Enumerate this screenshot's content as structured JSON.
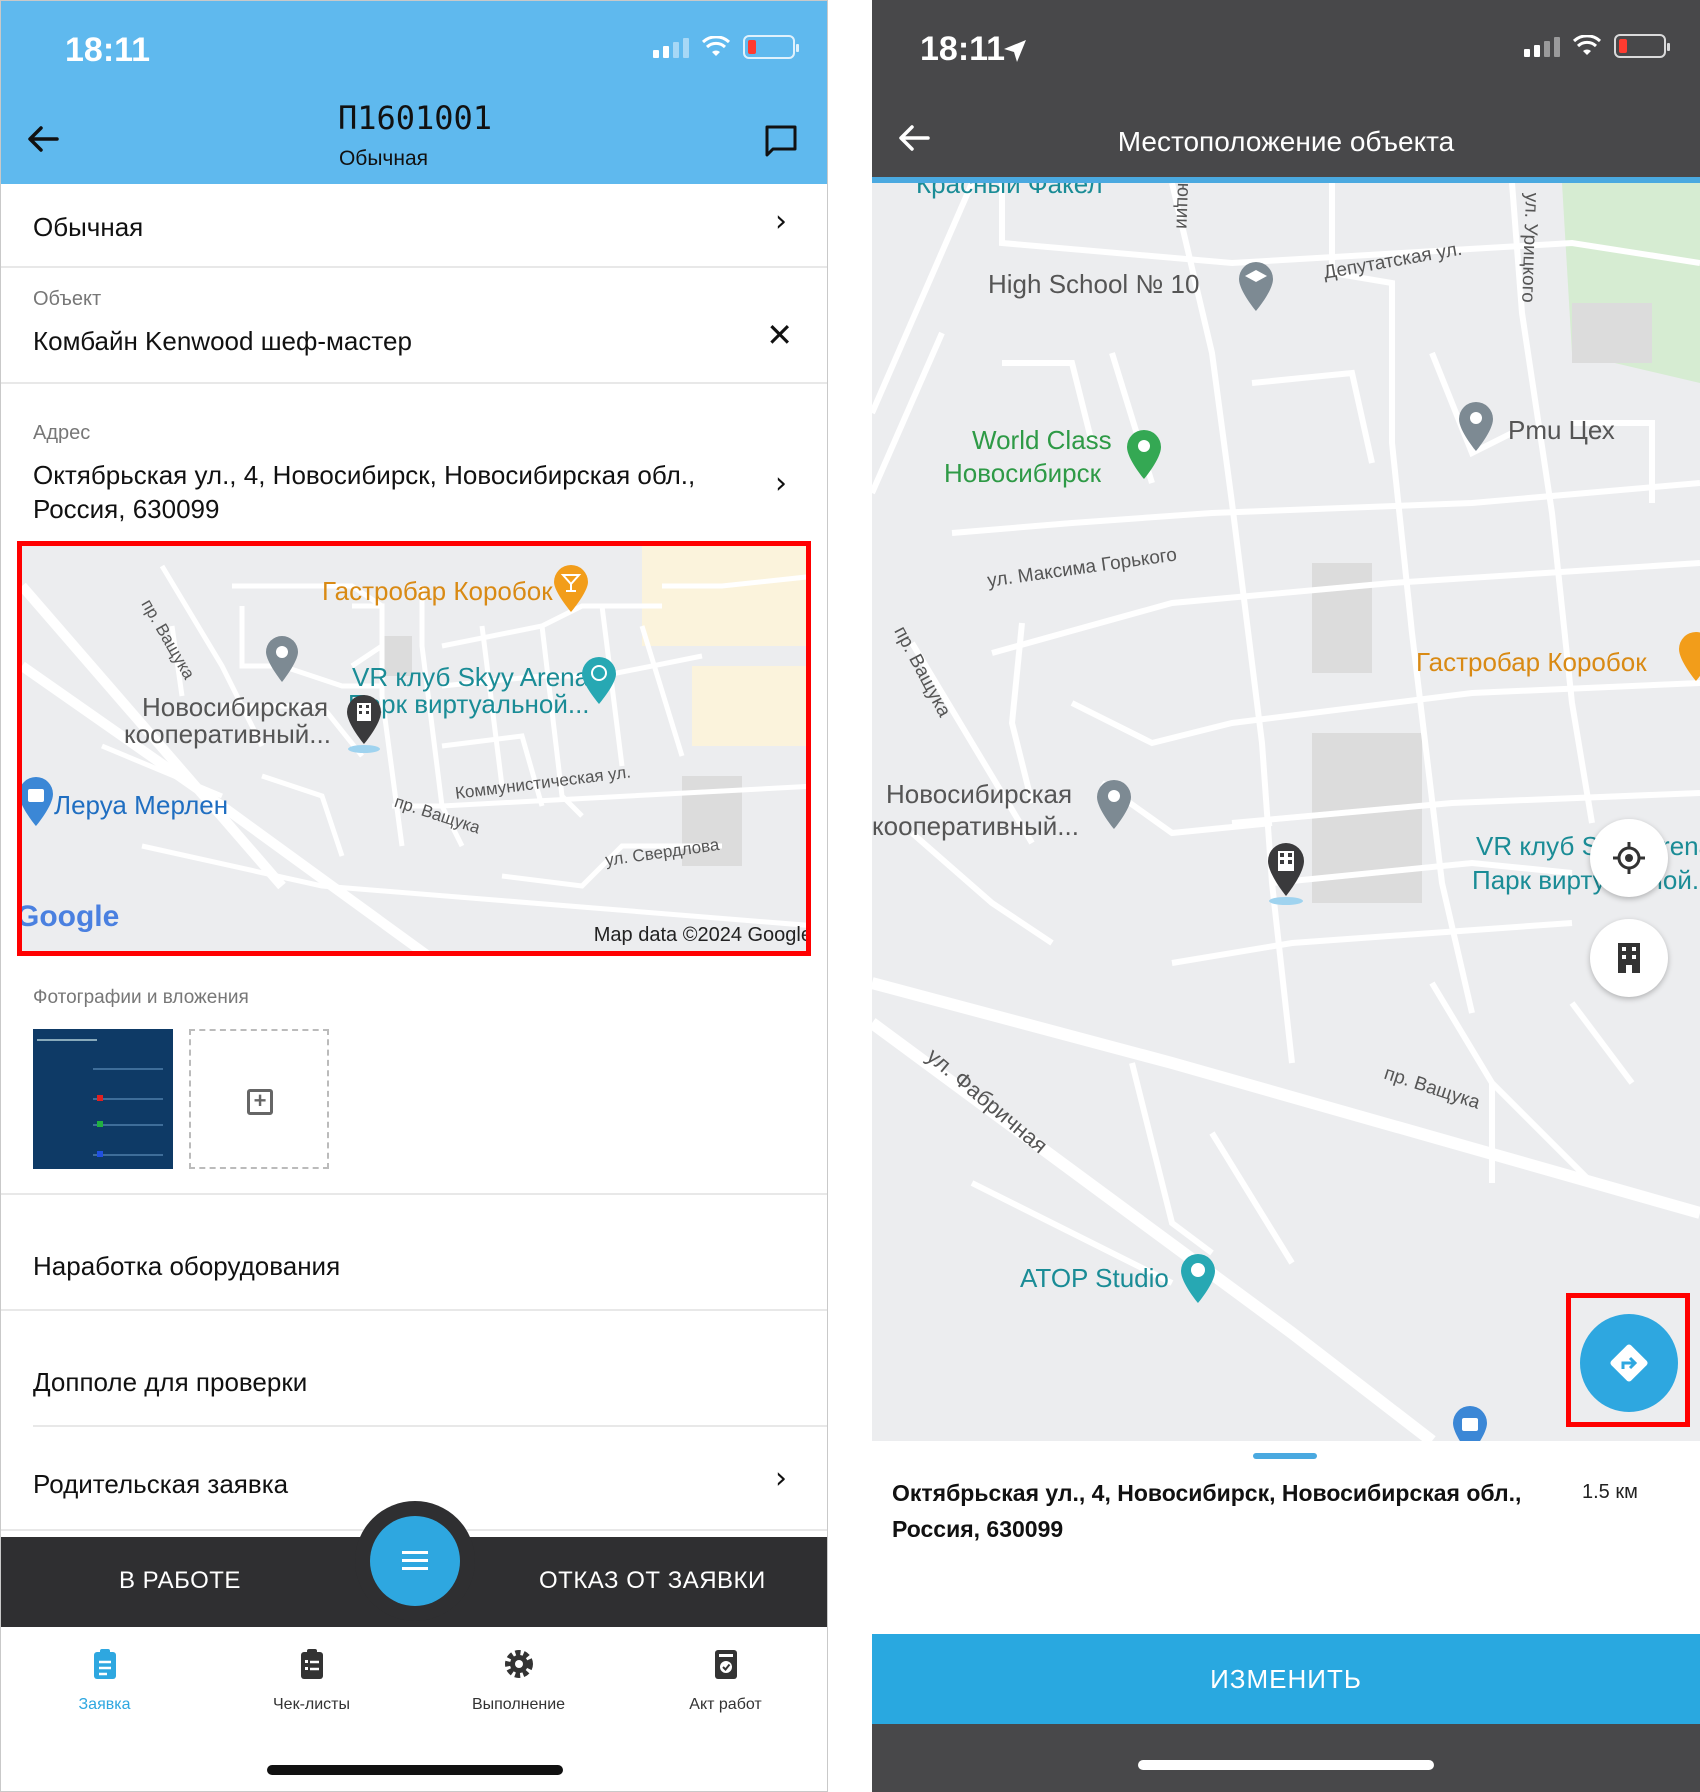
{
  "left": {
    "status": {
      "time": "18:11"
    },
    "header": {
      "title": "П1601001",
      "subtitle": "Обычная"
    },
    "type_row": {
      "value": "Обычная"
    },
    "object_row": {
      "label": "Объект",
      "value": "Комбайн Kenwood шеф-мастер"
    },
    "address_row": {
      "label": "Адрес",
      "value_line1": "Октябрьская ул., 4, Новосибирск, Новосибирская обл.,",
      "value_line2": "Россия, 630099"
    },
    "map": {
      "places": {
        "gastrobar": "Гастробар Коробок",
        "vr_line1": "VR клуб Skyy Arena,",
        "vr_line2": "Парк виртуальной...",
        "coop_line1": "Новосибирская",
        "coop_line2": "кооперативный...",
        "leroy": "Леруа Мерлен"
      },
      "streets": {
        "vashchuka1": "пр. Ващука",
        "vashchuka2": "пр. Ващука",
        "kommun": "Коммунистическая ул.",
        "sverdlova": "ул. Свердлова"
      },
      "google": "Google",
      "copyright": "Map data ©2024 Google"
    },
    "attachments": {
      "label": "Фотографии и вложения"
    },
    "fields": {
      "equipment": "Наработка оборудования",
      "extra": "Допполе для проверки",
      "parent": "Родительская заявка"
    },
    "actions": {
      "in_work": "В РАБОТЕ",
      "reject": "ОТКАЗ ОТ ЗАЯВКИ"
    },
    "tabs": [
      {
        "label": "Заявка",
        "icon": "clipboard-icon"
      },
      {
        "label": "Чек-листы",
        "icon": "checklist-icon"
      },
      {
        "label": "Выполнение",
        "icon": "gear-wrench-icon"
      },
      {
        "label": "Акт работ",
        "icon": "act-icon"
      }
    ],
    "colors": {
      "header": "#5fb9ee",
      "accent": "#2ea7e0",
      "actionbar": "#2f2f31",
      "highlight": "#ff0000"
    }
  },
  "right": {
    "status": {
      "time": "18:11"
    },
    "header": {
      "title": "Местоположение объекта"
    },
    "map": {
      "places": {
        "krasny": "Красный Факел",
        "school": "High School № 10",
        "worldclass1": "World Class",
        "worldclass2": "Новосибирск",
        "pmu": "Pmu Цех",
        "gastrobar": "Гастробар Коробок",
        "coop1": "Новосибирская",
        "coop2": "кооперативный...",
        "vr1": "VR клуб Skyy Arena,",
        "vr2": "Парк виртуальной...",
        "atop": "ATOP Studio"
      },
      "streets": {
        "deputat": "Депутатская ул.",
        "uritsk": "ул. Урицкого",
        "gorky": "ул. Максима Горького",
        "vashchuka1": "пр. Ващука",
        "vashchuka2": "пр. Ващука",
        "fabr": "ул. Фабричная",
        "kommun": "юции"
      }
    },
    "sheet": {
      "address_line1": "Октябрьская ул., 4, Новосибирск, Новосибирская обл.,",
      "address_line2": "Россия, 630099",
      "distance": "1.5 км"
    },
    "change_button": "ИЗМЕНИТЬ",
    "colors": {
      "header": "#48484a",
      "accent": "#29a8e0",
      "highlight": "#ff0000"
    }
  }
}
